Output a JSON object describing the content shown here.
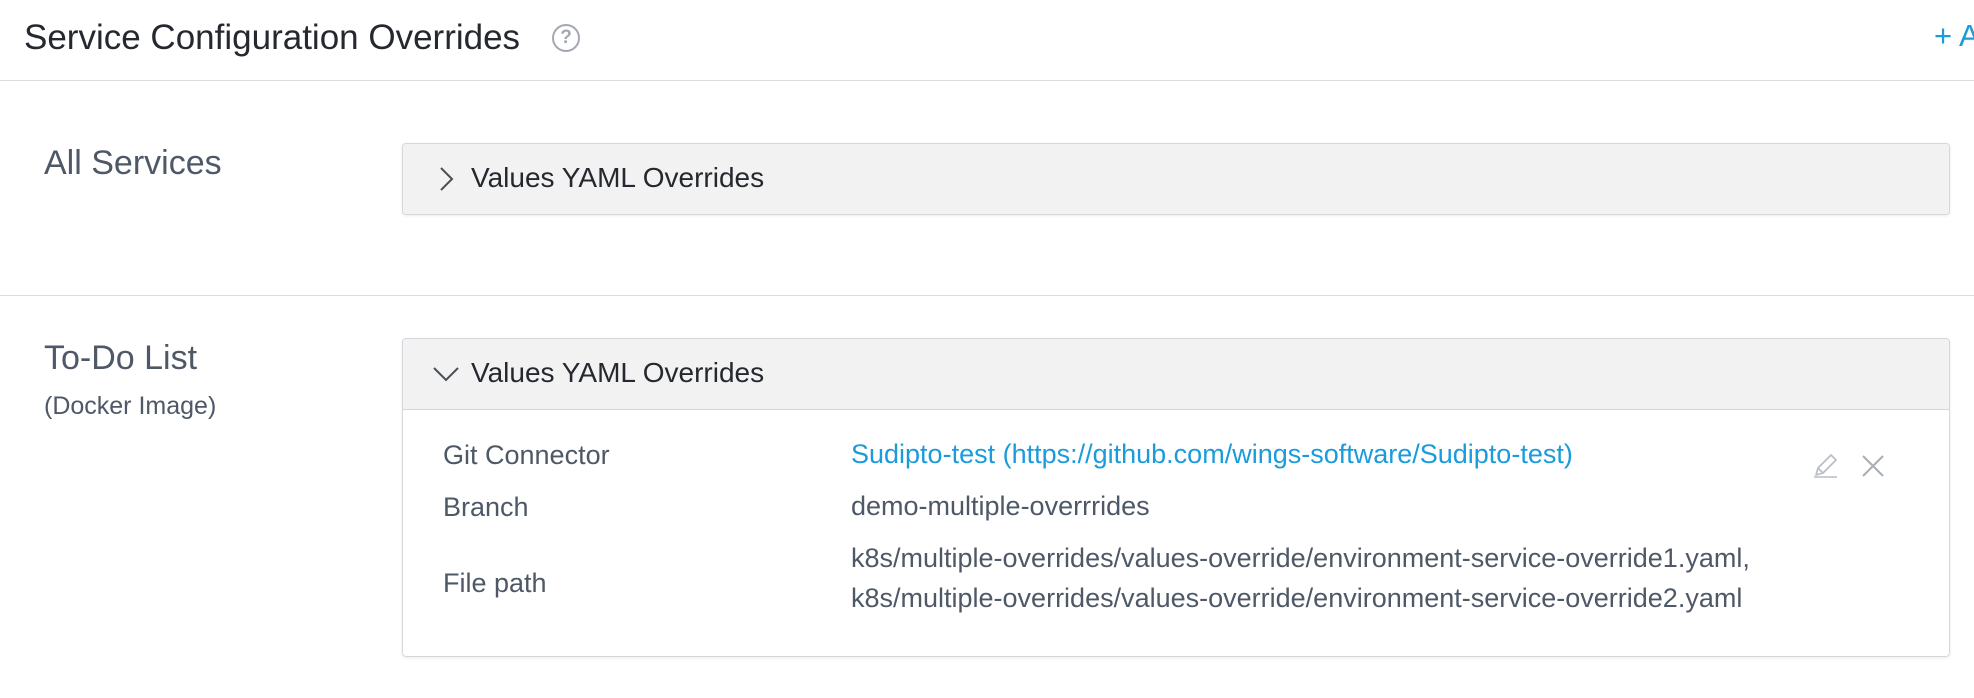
{
  "header": {
    "title": "Service Configuration Overrides",
    "help_symbol": "?",
    "add_link": "+ A"
  },
  "sections": [
    {
      "title": "All Services",
      "subtitle": "",
      "panel": {
        "label": "Values YAML Overrides",
        "expanded": false,
        "chevron_icon": "chevron-right-icon"
      }
    },
    {
      "title": "To-Do List",
      "subtitle": "(Docker Image)",
      "panel": {
        "label": "Values YAML Overrides",
        "expanded": true,
        "chevron_icon": "chevron-down-icon",
        "rows": {
          "git_connector": {
            "label": "Git Connector",
            "value": "Sudipto-test (https://github.com/wings-software/Sudipto-test)"
          },
          "branch": {
            "label": "Branch",
            "value": "demo-multiple-overrrides"
          },
          "file_path": {
            "label": "File path",
            "values": [
              "k8s/multiple-overrides/values-override/environment-service-override1.yaml,",
              "k8s/multiple-overrides/values-override/environment-service-override2.yaml"
            ]
          }
        },
        "actions": [
          "edit-icon",
          "delete-icon"
        ]
      }
    }
  ],
  "colors": {
    "accent": "#1a9bdc",
    "panel_header_bg": "#f2f2f2",
    "border": "#d4d7dc",
    "text": "#4e5866"
  }
}
